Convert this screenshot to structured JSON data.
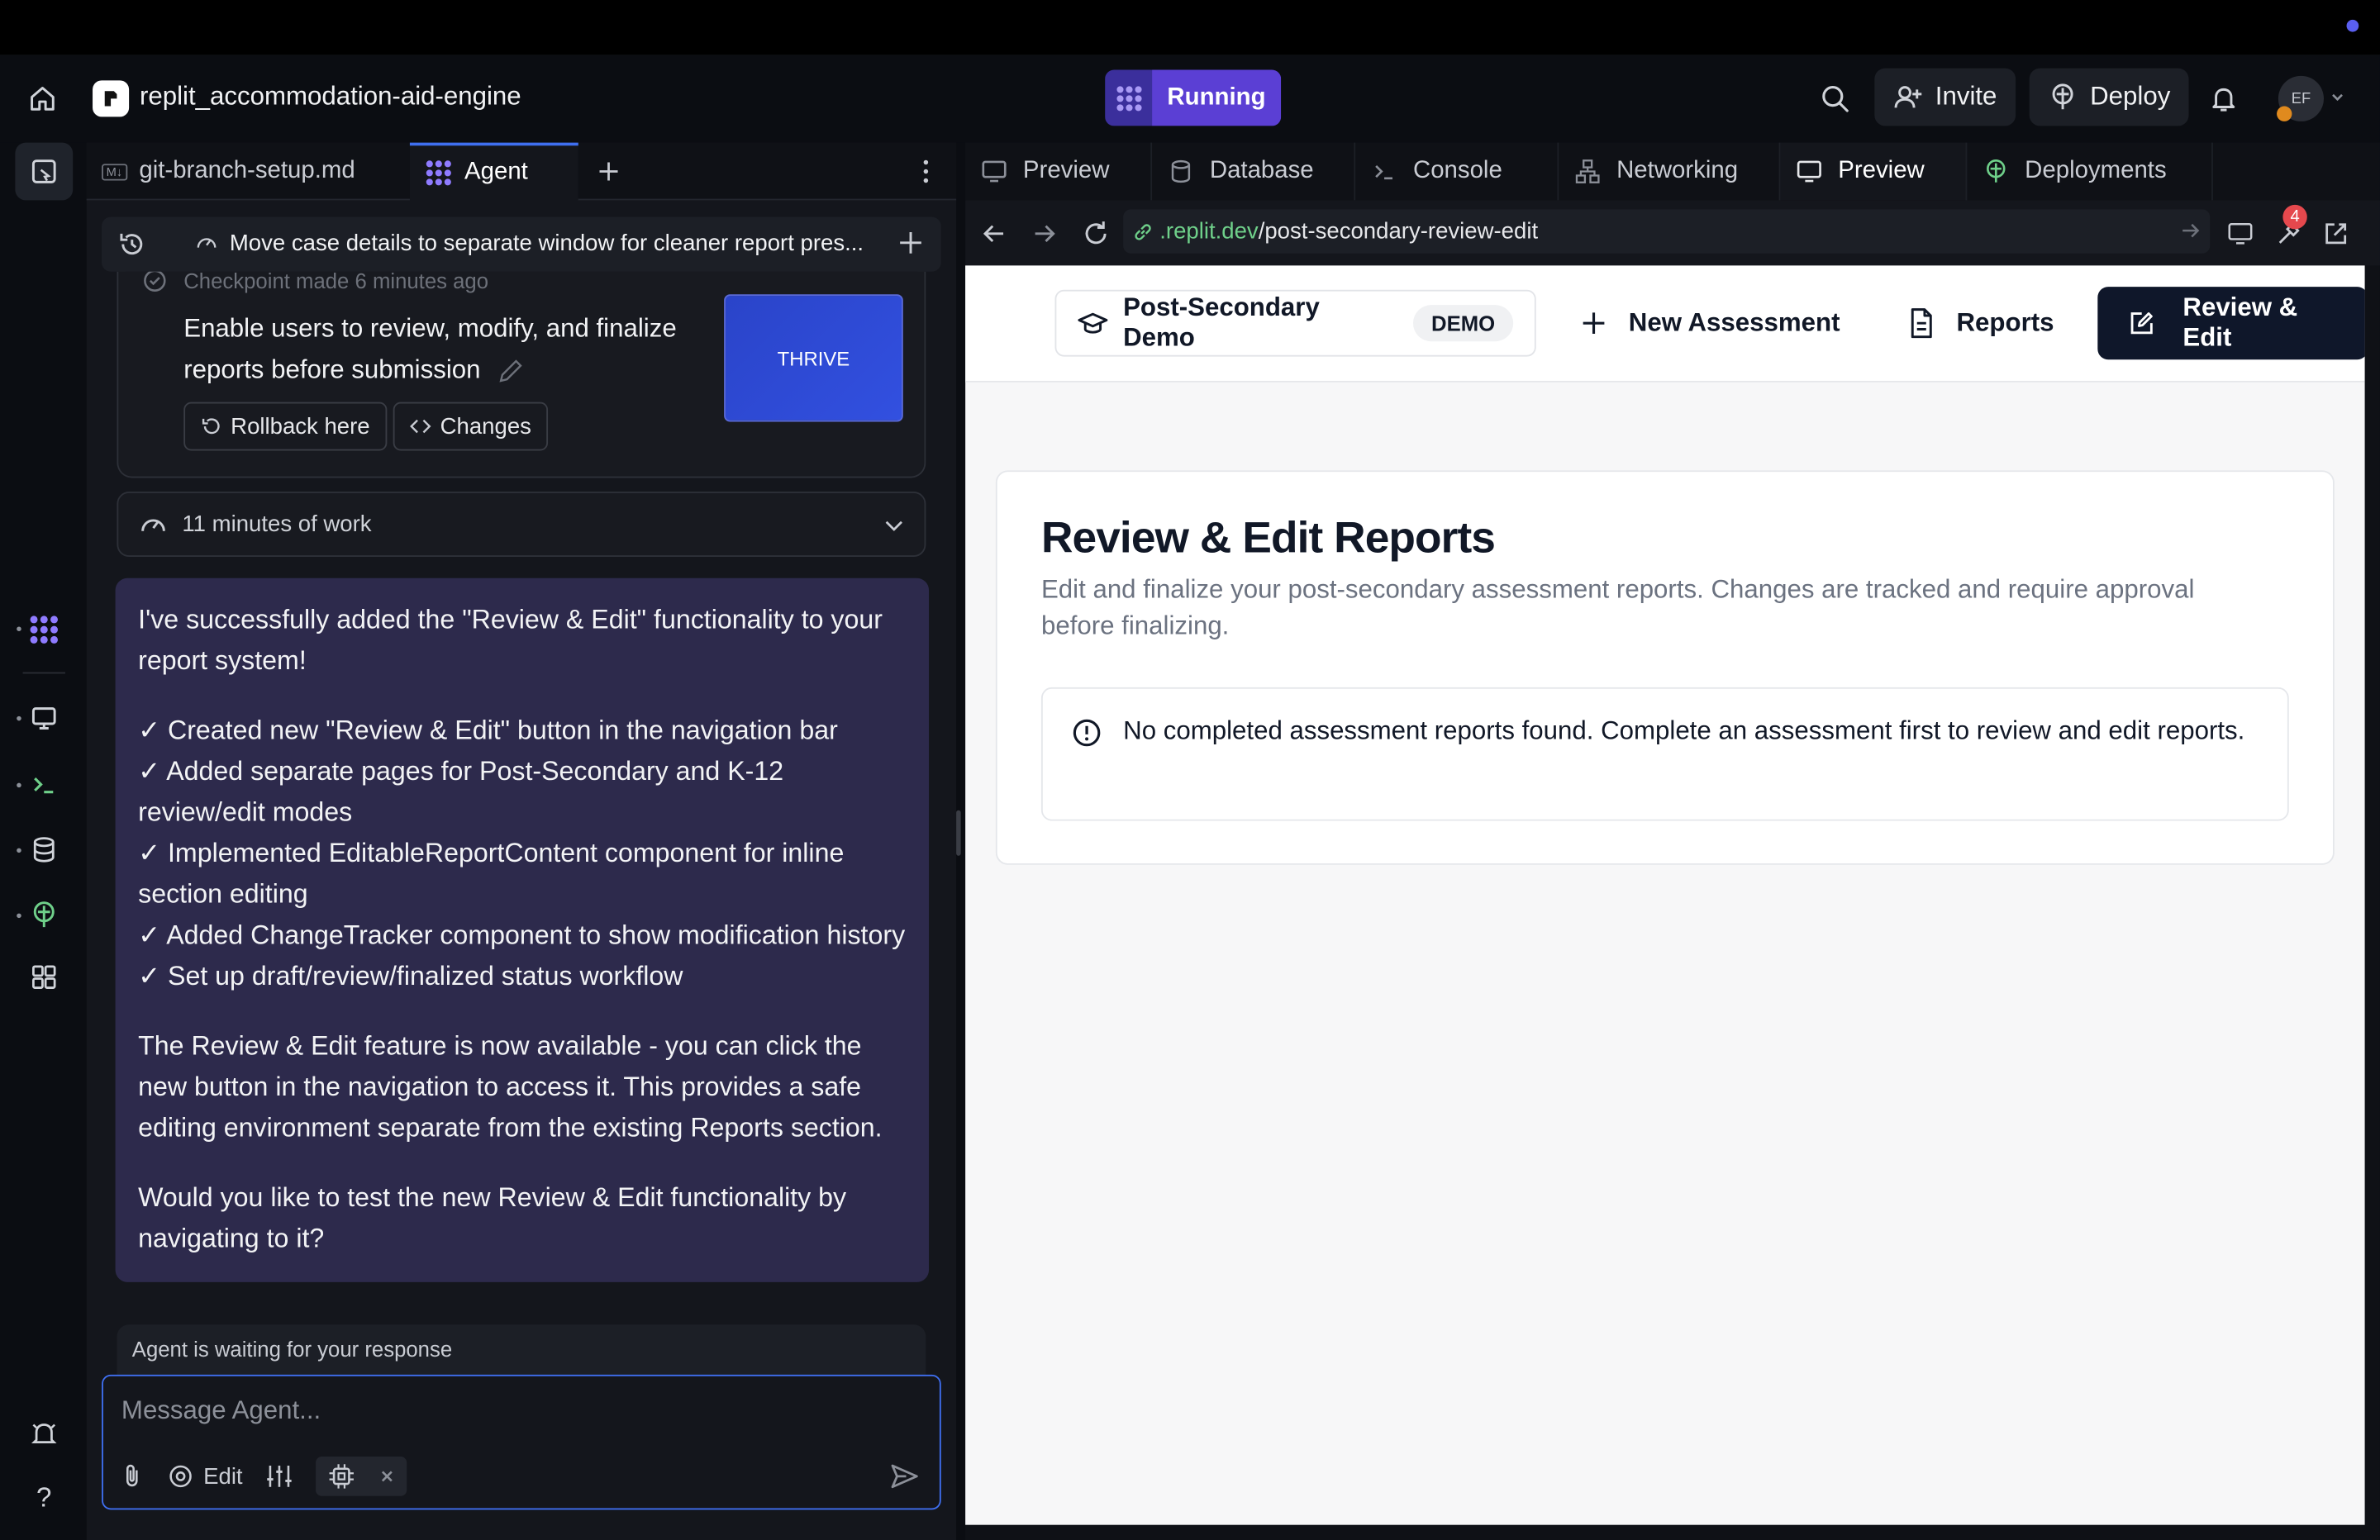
{
  "header": {
    "repl_name": "replit_accommodation-aid-engine",
    "run_status": "Running",
    "invite_label": "Invite",
    "deploy_label": "Deploy",
    "avatar_initials": "EF"
  },
  "left_tabs": [
    {
      "label": "git-branch-setup.md",
      "badge": "M↓"
    },
    {
      "label": "Agent"
    }
  ],
  "chat": {
    "title": "Move case details to separate window for cleaner report pres...",
    "checkpoint_made": "Checkpoint made 6 minutes ago",
    "checkpoint_text": "Enable users to review, modify, and finalize reports before submission",
    "thumbnail_label": "THRIVE",
    "rollback_label": "Rollback here",
    "changes_label": "Changes",
    "work_label": "11 minutes of work",
    "message": {
      "intro": "I've successfully added the \"Review & Edit\" functionality to your report system!",
      "checks": [
        "✓ Created new \"Review & Edit\" button in the navigation bar",
        "✓ Added separate pages for Post-Secondary and K-12 review/edit modes",
        "✓ Implemented EditableReportContent component for inline section editing",
        "✓ Added ChangeTracker component to show modification history",
        "✓ Set up draft/review/finalized status workflow"
      ],
      "para2": "The Review & Edit feature is now available - you can click the new button in the navigation to access it. This provides a safe editing environment separate from the existing Reports section.",
      "para3": "Would you like to test the new Review & Edit functionality by navigating to it?"
    },
    "waiting": "Agent is waiting for your response",
    "input_placeholder": "Message Agent...",
    "edit_label": "Edit"
  },
  "right_tabs": [
    "Preview",
    "Database",
    "Console",
    "Networking",
    "Preview",
    "Deployments"
  ],
  "url": {
    "host": ".replit.dev",
    "path": "/post-secondary-review-edit",
    "notification_count": "4"
  },
  "webapp": {
    "brand": "Post-Secondary Demo",
    "demo_badge": "DEMO",
    "nav_new": "New Assessment",
    "nav_reports": "Reports",
    "nav_review": "Review & Edit",
    "page_title": "Review & Edit Reports",
    "page_desc": "Edit and finalize your post-secondary assessment reports. Changes are tracked and require approval before finalizing.",
    "alert_text": "No completed assessment reports found. Complete an assessment first to review and edit reports."
  },
  "colors": {
    "accent_blue": "#3f6ff0",
    "running_purple": "#5b3fd4",
    "agent_bubble": "#2d2a4c",
    "nav_active": "#0f172a",
    "url_green": "#6fd08a"
  }
}
